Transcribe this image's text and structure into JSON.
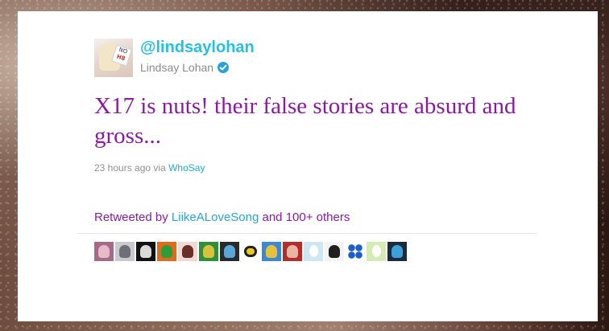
{
  "tweet": {
    "handle": "@lindsaylohan",
    "full_name": "Lindsay Lohan",
    "verified": true,
    "text": "X17 is nuts! their false stories are absurd and gross...",
    "time": "23 hours ago",
    "via_label": "via",
    "source": "WhoSay",
    "avatar_sign_top": "NO",
    "avatar_sign_bottom": "H8"
  },
  "retweets": {
    "prefix": "Retweeted by",
    "user": "LiikeALoveSong",
    "suffix": "and 100+ others"
  },
  "retweeter_avatars": [
    {
      "icon": "user-avatar",
      "bg": "#a46b86",
      "fg": "#e8b9c9"
    },
    {
      "icon": "user-avatar",
      "bg": "#c9c9cf",
      "fg": "#6e6e78"
    },
    {
      "icon": "user-avatar",
      "bg": "#111111",
      "fg": "#d9d9d9"
    },
    {
      "icon": "user-avatar",
      "bg": "#e26a1c",
      "fg": "#2f9c3a"
    },
    {
      "icon": "user-avatar",
      "bg": "#f1d9d4",
      "fg": "#6a2f2a"
    },
    {
      "icon": "user-avatar",
      "bg": "#2f8f3b",
      "fg": "#d8c23a"
    },
    {
      "icon": "user-avatar",
      "bg": "#2a2a2a",
      "fg": "#5aa6d8"
    },
    {
      "icon": "headphones-avatar",
      "bg": "#ffffff",
      "fg": "#e7c825"
    },
    {
      "icon": "user-avatar",
      "bg": "#3a88d6",
      "fg": "#e5c23b"
    },
    {
      "icon": "user-avatar",
      "bg": "#b52d2a",
      "fg": "#e9b5a3"
    },
    {
      "icon": "egg-avatar",
      "bg": "#cfe7f2",
      "fg": "#ffffff"
    },
    {
      "icon": "user-avatar",
      "bg": "#f3f3f3",
      "fg": "#1f1f1f"
    },
    {
      "icon": "dots-avatar",
      "bg": "#ffffff",
      "fg": "#1b5fc7"
    },
    {
      "icon": "egg-avatar",
      "bg": "#d4ebb3",
      "fg": "#ffffff"
    },
    {
      "icon": "user-avatar",
      "bg": "#1b2a3c",
      "fg": "#3ba2d9"
    }
  ],
  "colors": {
    "link": "#23a7d6",
    "handle": "#23c0e8",
    "tweet_text": "#8a1aa4",
    "meta": "#8f8f8f",
    "verified_badge": "#2aa1d9"
  }
}
